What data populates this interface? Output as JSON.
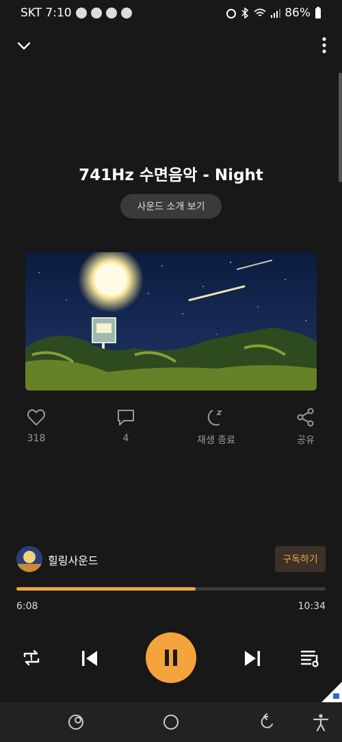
{
  "status_bar": {
    "carrier_time": "SKT 7:10",
    "battery": "86%",
    "icons": [
      "notification-icons",
      "alarm-icon",
      "bluetooth-icon",
      "wifi-icon",
      "signal-icon",
      "battery-icon"
    ]
  },
  "player": {
    "title": "741Hz 수면음악 - Night",
    "intro_button": "사운드 소개 보기",
    "likes": "318",
    "comments": "4",
    "sleep_timer_label": "재생 종료",
    "share_label": "공유",
    "artist": "힐링사운드",
    "subscribe_label": "구독하기",
    "elapsed": "6:08",
    "duration": "10:34",
    "progress": 0.58
  },
  "colors": {
    "accent": "#f5a33c",
    "background": "#181818"
  }
}
